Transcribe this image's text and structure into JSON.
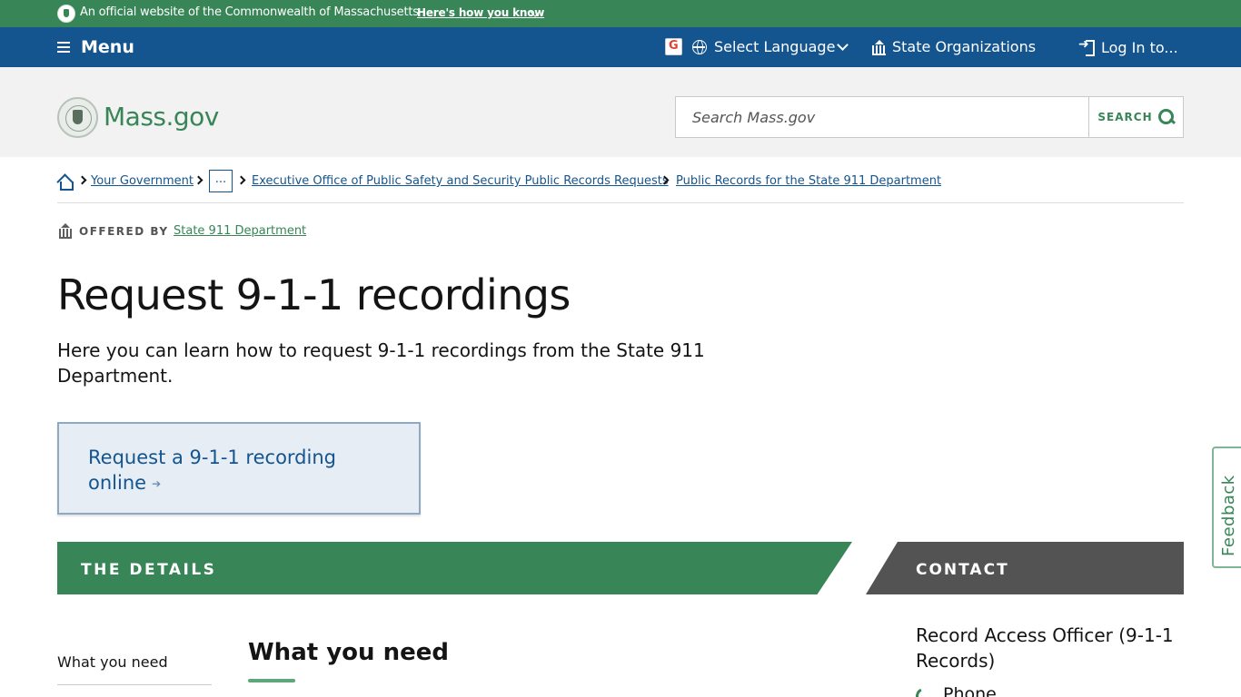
{
  "official_banner": {
    "text": "An official website of the Commonwealth of Massachusetts",
    "how_you_know": "Here's how you know"
  },
  "utility_nav": {
    "menu": "Menu",
    "language": "Select Language",
    "state_orgs": "State Organizations",
    "login": "Log In to..."
  },
  "header": {
    "logo_text": "Mass.gov",
    "search_placeholder": "Search Mass.gov",
    "search_button": "SEARCH"
  },
  "breadcrumb": {
    "items": [
      "Your Government",
      "...",
      "Executive Office of Public Safety and Security Public Records Requests",
      "Public Records for the State 911 Department"
    ]
  },
  "offered_by": {
    "label": "OFFERED BY",
    "org": "State 911 Department"
  },
  "page": {
    "title": "Request 9-1-1 recordings",
    "lede": "Here you can learn how to request 9-1-1 recordings from the State 911 Department.",
    "cta": "Request a 9-1-1 recording online"
  },
  "details": {
    "bar_label": "THE DETAILS",
    "toc": [
      "What you need"
    ],
    "section_heading": "What you need"
  },
  "contact": {
    "bar_label": "CONTACT",
    "name": "Record Access Officer (9-1-1 Records)",
    "phone_label": "Phone"
  },
  "feedback": {
    "label": "Feedback"
  },
  "colors": {
    "green": "#388557",
    "blue": "#14558f",
    "gray": "#535353"
  }
}
